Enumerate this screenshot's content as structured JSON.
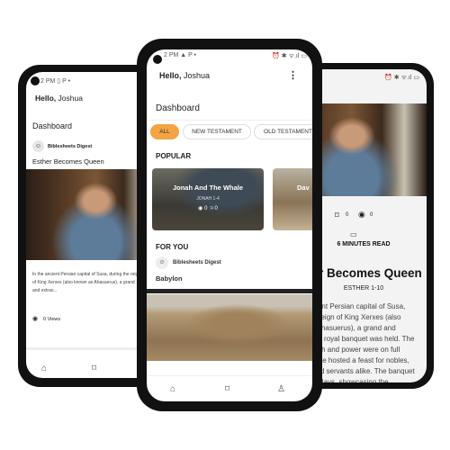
{
  "status_time": "2 PM",
  "left_phone": {
    "greeting_bold": "Hello,",
    "greeting_name": "Joshua",
    "title": "Dashboard",
    "author": "Biblesheets Digest",
    "post_title": "Esther Becomes Queen",
    "excerpt": "In the ancient Persian capital of Susa, during the reign of King Xerxes (also known as Ahasuerus), a grand and extrav...",
    "views": "0 Views",
    "nav": [
      "home-icon",
      "bookmark-icon"
    ]
  },
  "center_phone": {
    "greeting_bold": "Hello,",
    "greeting_name": "Joshua",
    "title": "Dashboard",
    "filters": [
      {
        "label": "ALL",
        "active": true
      },
      {
        "label": "NEW TESTAMENT",
        "active": false
      },
      {
        "label": "OLD TESTAMENT",
        "active": false
      }
    ],
    "popular_heading": "POPULAR",
    "popular_cards": [
      {
        "title": "Jonah And The Whale",
        "ref": "JONAH 1-4",
        "views": "0",
        "bookmarks": "0"
      },
      {
        "title": "Dav"
      }
    ],
    "for_you_heading": "FOR YOU",
    "for_you_author": "Biblesheets Digest",
    "for_you_title": "Babylon",
    "nav": [
      "home-icon",
      "bookmark-icon",
      "profile-icon"
    ],
    "accent": "#f5a445"
  },
  "right_phone": {
    "bookmarks": "0",
    "views": "0",
    "read_time": "6 MINUTES READ",
    "title": "Esther Becomes Queen",
    "ref": "ESTHER 1-10",
    "body": "In the ancient Persian capital of Susa, during the reign of King Xerxes (also known as Ahasuerus), a grand and extravagant royal banquet was held. The king's wealth and power were on full display as he hosted a feast for nobles, officials, and servants alike. The banquet lasted 180 days, showcasing the"
  }
}
